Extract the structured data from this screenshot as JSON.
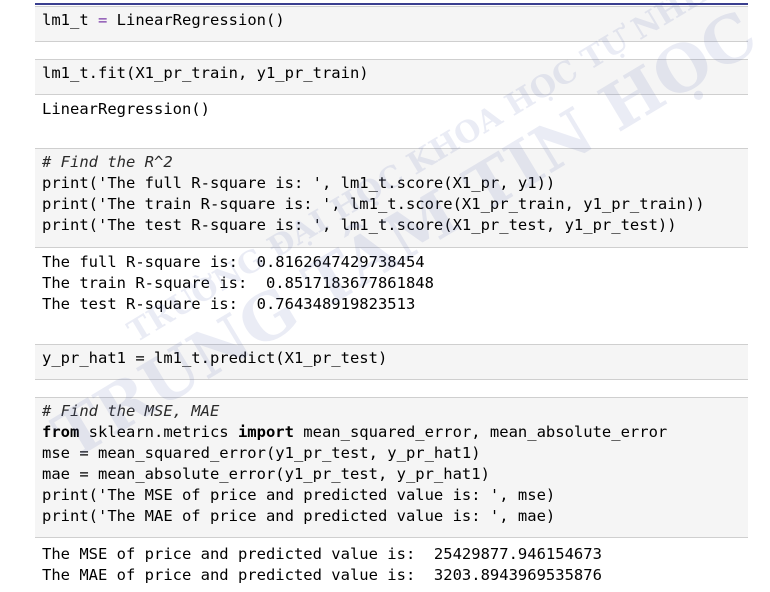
{
  "watermark": {
    "line1": "TRƯỜNG ĐẠI HỌC KHOA HỌC TỰ NHIÊN",
    "line2": "TRUNG TÂM TIN HỌC",
    "color": "#5f69af"
  },
  "cells": [
    {
      "type": "code",
      "lines": [
        [
          "lm1_t ",
          "= ",
          "LinearRegression()"
        ]
      ]
    },
    {
      "type": "code",
      "lines": [
        [
          "lm1_t.fit(X1_pr_train, y1_pr_train)"
        ]
      ]
    },
    {
      "type": "output",
      "lines": [
        "LinearRegression()"
      ]
    },
    {
      "type": "code",
      "lines": [
        "# Find the R^2",
        "print('The full R-square is: ', lm1_t.score(X1_pr, y1))",
        "print('The train R-square is: ', lm1_t.score(X1_pr_train, y1_pr_train))",
        "print('The test R-square is: ', lm1_t.score(X1_pr_test, y1_pr_test))"
      ]
    },
    {
      "type": "output",
      "lines": [
        "The full R-square is:  0.8162647429738454",
        "The train R-square is:  0.8517183677861848",
        "The test R-square is:  0.764348919823513"
      ]
    },
    {
      "type": "code",
      "lines": [
        "y_pr_hat1 = lm1_t.predict(X1_pr_test)"
      ]
    },
    {
      "type": "code",
      "lines": [
        "# Find the MSE, MAE",
        "from sklearn.metrics import mean_squared_error, mean_absolute_error",
        "mse = mean_squared_error(y1_pr_test, y_pr_hat1)",
        "mae = mean_absolute_error(y1_pr_test, y_pr_hat1)",
        "print('The MSE of price and predicted value is: ', mse)",
        "print('The MAE of price and predicted value is: ', mae)"
      ]
    },
    {
      "type": "output",
      "lines": [
        "The MSE of price and predicted value is:  25429877.946154673",
        "The MAE of price and predicted value is:  3203.8943969535876"
      ]
    }
  ]
}
